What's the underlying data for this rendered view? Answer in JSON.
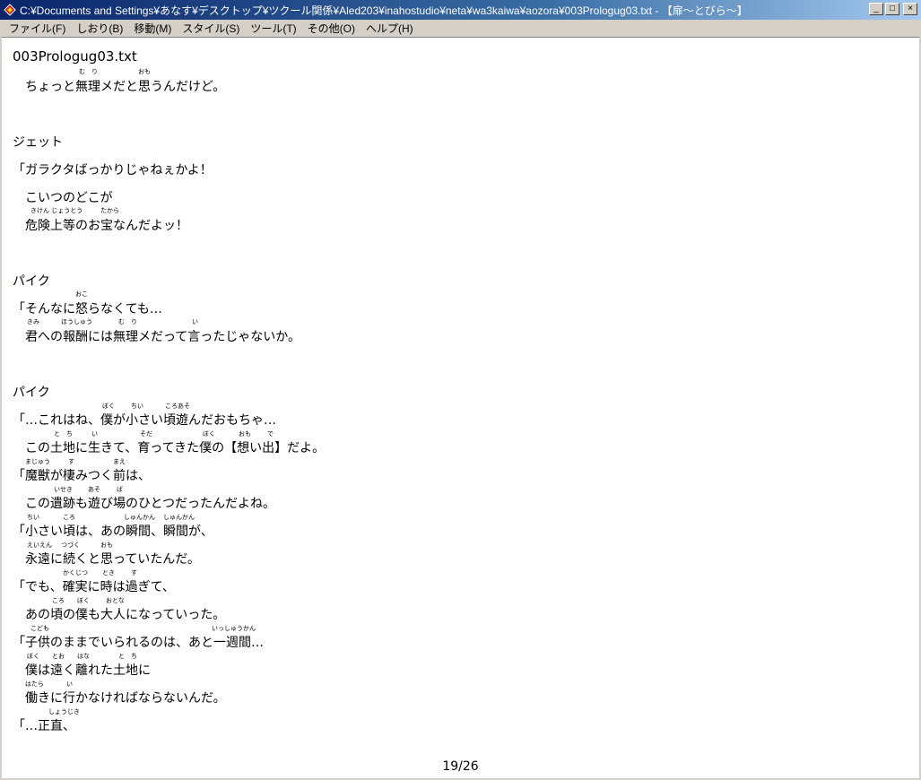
{
  "window": {
    "title": "C:¥Documents and Settings¥あなす¥デスクトップ¥ツクール関係¥Aled203¥inahostudio¥neta¥wa3kaiwa¥aozora¥003Prologug03.txt - 【扉〜とびら〜】",
    "minimize": "_",
    "maximize": "□",
    "close": "×"
  },
  "menu": [
    "ファイル(F)",
    "しおり(B)",
    "移動(M)",
    "スタイル(S)",
    "ツール(T)",
    "その他(O)",
    "ヘルプ(H)"
  ],
  "doc": {
    "filename": "003Prologug03.txt",
    "lines": [
      "　ちょっと無理メだと思うんだけど。",
      "ジェット",
      "「ガラクタばっかりじゃねぇかよ！",
      "　こいつのどこが",
      "　危険上等のお宝なんだよッ！",
      "パイク",
      "「そんなに怒らなくても…",
      "　君への報酬には無理メだって言ったじゃないか。",
      "パイク",
      "「…これはね、僕が小さい頃遊んだおもちゃ…",
      "　この土地に生きて、育ってきた僕の【想い出】だよ。",
      "「魔獣が棲みつく前は、",
      "　この遺跡も遊び場のひとつだったんだよね。",
      "「小さい頃は、あの瞬間、瞬間が、",
      "　永遠に続くと思っていたんだ。",
      "「でも、確実に時は過ぎて、",
      "　あの頃の僕も大人になっていった。",
      "「子供のままでいられるのは、あと一週間…",
      "　僕は遠く離れた土地に",
      "　働きに行かなければならないんだ。",
      "「…正直、"
    ],
    "ruby": [
      "む　り",
      "おも",
      "きけん じょうとう",
      "たから",
      "おこ",
      "きみ",
      "ほうしゅう",
      "む　り",
      "い",
      "ぼく",
      "ちい",
      "ころあそ",
      "と　ち",
      "い",
      "そだ",
      "ぼく",
      "おも",
      "で",
      "まじゅう",
      "す",
      "まえ",
      "いせき",
      "あそ",
      "ば",
      "ちい",
      "ころ",
      "しゅんかん",
      "しゅんかん",
      "えいえん",
      "つづく",
      "おも",
      "かくじつ",
      "とき",
      "す",
      "ころ",
      "ぼく",
      "おとな",
      "こども",
      "いっしゅうかん",
      "ぼく",
      "とお",
      "はな",
      "と　ち",
      "はたら",
      "い",
      "しょうじき"
    ],
    "page": "19/26"
  }
}
